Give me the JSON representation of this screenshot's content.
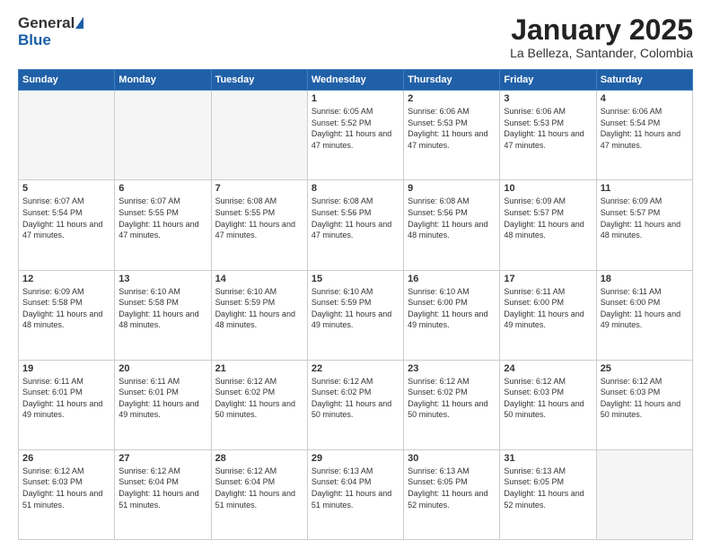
{
  "header": {
    "logo_general": "General",
    "logo_blue": "Blue",
    "month_title": "January 2025",
    "location": "La Belleza, Santander, Colombia"
  },
  "days_of_week": [
    "Sunday",
    "Monday",
    "Tuesday",
    "Wednesday",
    "Thursday",
    "Friday",
    "Saturday"
  ],
  "weeks": [
    [
      {
        "day": "",
        "empty": true
      },
      {
        "day": "",
        "empty": true
      },
      {
        "day": "",
        "empty": true
      },
      {
        "day": "1",
        "sunrise": "6:05 AM",
        "sunset": "5:52 PM",
        "daylight": "11 hours and 47 minutes."
      },
      {
        "day": "2",
        "sunrise": "6:06 AM",
        "sunset": "5:53 PM",
        "daylight": "11 hours and 47 minutes."
      },
      {
        "day": "3",
        "sunrise": "6:06 AM",
        "sunset": "5:53 PM",
        "daylight": "11 hours and 47 minutes."
      },
      {
        "day": "4",
        "sunrise": "6:06 AM",
        "sunset": "5:54 PM",
        "daylight": "11 hours and 47 minutes."
      }
    ],
    [
      {
        "day": "5",
        "sunrise": "6:07 AM",
        "sunset": "5:54 PM",
        "daylight": "11 hours and 47 minutes."
      },
      {
        "day": "6",
        "sunrise": "6:07 AM",
        "sunset": "5:55 PM",
        "daylight": "11 hours and 47 minutes."
      },
      {
        "day": "7",
        "sunrise": "6:08 AM",
        "sunset": "5:55 PM",
        "daylight": "11 hours and 47 minutes."
      },
      {
        "day": "8",
        "sunrise": "6:08 AM",
        "sunset": "5:56 PM",
        "daylight": "11 hours and 47 minutes."
      },
      {
        "day": "9",
        "sunrise": "6:08 AM",
        "sunset": "5:56 PM",
        "daylight": "11 hours and 48 minutes."
      },
      {
        "day": "10",
        "sunrise": "6:09 AM",
        "sunset": "5:57 PM",
        "daylight": "11 hours and 48 minutes."
      },
      {
        "day": "11",
        "sunrise": "6:09 AM",
        "sunset": "5:57 PM",
        "daylight": "11 hours and 48 minutes."
      }
    ],
    [
      {
        "day": "12",
        "sunrise": "6:09 AM",
        "sunset": "5:58 PM",
        "daylight": "11 hours and 48 minutes."
      },
      {
        "day": "13",
        "sunrise": "6:10 AM",
        "sunset": "5:58 PM",
        "daylight": "11 hours and 48 minutes."
      },
      {
        "day": "14",
        "sunrise": "6:10 AM",
        "sunset": "5:59 PM",
        "daylight": "11 hours and 48 minutes."
      },
      {
        "day": "15",
        "sunrise": "6:10 AM",
        "sunset": "5:59 PM",
        "daylight": "11 hours and 49 minutes."
      },
      {
        "day": "16",
        "sunrise": "6:10 AM",
        "sunset": "6:00 PM",
        "daylight": "11 hours and 49 minutes."
      },
      {
        "day": "17",
        "sunrise": "6:11 AM",
        "sunset": "6:00 PM",
        "daylight": "11 hours and 49 minutes."
      },
      {
        "day": "18",
        "sunrise": "6:11 AM",
        "sunset": "6:00 PM",
        "daylight": "11 hours and 49 minutes."
      }
    ],
    [
      {
        "day": "19",
        "sunrise": "6:11 AM",
        "sunset": "6:01 PM",
        "daylight": "11 hours and 49 minutes."
      },
      {
        "day": "20",
        "sunrise": "6:11 AM",
        "sunset": "6:01 PM",
        "daylight": "11 hours and 49 minutes."
      },
      {
        "day": "21",
        "sunrise": "6:12 AM",
        "sunset": "6:02 PM",
        "daylight": "11 hours and 50 minutes."
      },
      {
        "day": "22",
        "sunrise": "6:12 AM",
        "sunset": "6:02 PM",
        "daylight": "11 hours and 50 minutes."
      },
      {
        "day": "23",
        "sunrise": "6:12 AM",
        "sunset": "6:02 PM",
        "daylight": "11 hours and 50 minutes."
      },
      {
        "day": "24",
        "sunrise": "6:12 AM",
        "sunset": "6:03 PM",
        "daylight": "11 hours and 50 minutes."
      },
      {
        "day": "25",
        "sunrise": "6:12 AM",
        "sunset": "6:03 PM",
        "daylight": "11 hours and 50 minutes."
      }
    ],
    [
      {
        "day": "26",
        "sunrise": "6:12 AM",
        "sunset": "6:03 PM",
        "daylight": "11 hours and 51 minutes."
      },
      {
        "day": "27",
        "sunrise": "6:12 AM",
        "sunset": "6:04 PM",
        "daylight": "11 hours and 51 minutes."
      },
      {
        "day": "28",
        "sunrise": "6:12 AM",
        "sunset": "6:04 PM",
        "daylight": "11 hours and 51 minutes."
      },
      {
        "day": "29",
        "sunrise": "6:13 AM",
        "sunset": "6:04 PM",
        "daylight": "11 hours and 51 minutes."
      },
      {
        "day": "30",
        "sunrise": "6:13 AM",
        "sunset": "6:05 PM",
        "daylight": "11 hours and 52 minutes."
      },
      {
        "day": "31",
        "sunrise": "6:13 AM",
        "sunset": "6:05 PM",
        "daylight": "11 hours and 52 minutes."
      },
      {
        "day": "",
        "empty": true
      }
    ]
  ],
  "labels": {
    "sunrise": "Sunrise:",
    "sunset": "Sunset:",
    "daylight": "Daylight:"
  }
}
